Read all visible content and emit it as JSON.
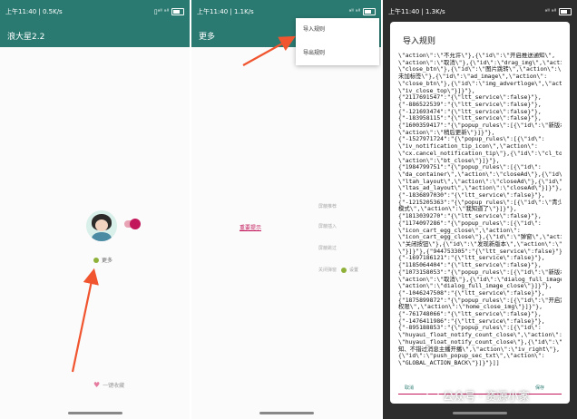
{
  "screen1": {
    "status_time": "上午11:40 | 0.5K/s",
    "status_right": "▯ᵃˡˡ ᵃˡˡ",
    "title": "浪大星2.2",
    "more_label": "更多",
    "favorite_label": "一键收藏"
  },
  "screen2": {
    "status_time": "上午11:40 | 1.1K/s",
    "status_right": "ᵃˡˡ ᵃˡˡ",
    "title": "更多",
    "menu": [
      {
        "label": "导入规则"
      },
      {
        "label": "导出规则"
      }
    ],
    "grey_labels": [
      "屏蔽推荐",
      "屏蔽插入",
      "屏蔽跳过",
      "关闭弹窗",
      "无障碍"
    ],
    "link_label": "重要提示",
    "settings_label": "设置"
  },
  "screen3": {
    "status_time": "上午11:40 | 1.3K/s",
    "dialog_title": "导入规则",
    "rules_text": "\\\"action\\\":\\\"不允许\\\"},{\\\"id\\\":\\\"开启推送通知\\\",\n\\\"action\\\":\\\"取消\\\"},{\\\"id\\\":\\\"drag_img\\\",\\\"action\\\":\n\\\"close_btn\\\"},{\\\"id\\\":\\\"图片跳转\\\",\\\"action\\\":\\\"此图片\n未加标签\\\"},{\\\"id\\\":\\\"ad_image\\\",\\\"action\\\":\n\\\"close_btn\\\"},{\\\"id\\\":\\\"img_advertloge\\\",\\\"action\\\":\n\\\"iv_close_top\\\"}]}\"},\n{\"2117691547\":\"{\\\"ltt_service\\\":false}\"},\n{\"-886522539\":\"{\\\"ltt_service\\\":false}\"},\n{\"-121693474\":\"{\\\"ltt_service\\\":false}\"},\n{\"-183958115\":\"{\\\"ltt_service\\\":false}\"},\n{\"1600359417\":\"{\\\"popup_rules\\\":[{\\\"id\\\":\\\"新版本\\\",\n\\\"action\\\":\\\"稍后更新\\\"}]}\"},\n{\"-1527971724\":\"{\\\"popup_rules\\\":[{\\\"id\\\":\n\\\"iv_notification_tip_icon\\\",\\\"action\\\":\n\\\"cx.cancel_notification_tip\\\"},{\\\"id\\\":\\\"cl_top\\\",\n\\\"action\\\":\\\"bt_close\\\"}]}\"},\n{\"1984799751\":\"{\\\"popup_rules\\\":[{\\\"id\\\":\n\\\"da_container\\\",\\\"action\\\":\\\"closeAd\\\"},{\\\"id\\\":\n\\\"ltah_layout\\\",\\\"action\\\":\\\"closeAd\\\"},{\\\"id\\\":\n\\\"ltas_ad_layout\\\",\\\"action\\\":\\\"closeAd\\\"}]}\"},\n{\"-1836897030\":\"{\\\"ltt_service\\\":false}\"},\n{\"-1215205363\":\"{\\\"popup_rules\\\":[{\\\"id\\\":\\\"青少年\n模式\\\",\\\"action\\\":\\\"我知道了\\\"}]}\"},\n{\"1813039270\":\"{\\\"ltt_service\\\":false}\"},\n{\"1174097286\":\"{\\\"popup_rules\\\":[{\\\"id\\\":\n\\\"icon_cart_egg_close\\\",\\\"action\\\":\n\\\"icon_cart_egg_close\\\"},{\\\"id\\\":\\\"弹窗\\\",\\\"action\\\":\n\\\"关闭按钮\\\"},{\\\"id\\\":\\\"发现新版本\\\",\\\"action\\\":\\\"取消\n\\\"}]}\"},{\"944753305\":\"{\\\"ltt_service\\\":false}\"},\n{\"-1697186121\":\"{\\\"ltt_service\\\":false}\"},\n{\"1185064404\":\"{\\\"ltt_service\\\":false}\"},\n{\"1073158053\":\"{\\\"popup_rules\\\":[{\\\"id\\\":\\\"新版本\\\",\n\\\"action\\\":\\\"取消\\\"},{\\\"id\\\":\\\"dialog_full_image\\\",\n\\\"action\\\":\\\"dialog_full_image_close\\\"}]}\"},\n{\"-1046247508\":\"{\\\"ltt_service\\\":false}\"},\n{\"1875899872\":\"{\\\"popup_rules\\\":[{\\\"id\\\":\\\"开启定位\n权限\\\",\\\"action\\\":\\\"home_close_img\\\"}]}\"},\n{\"-761748066\":\"{\\\"ltt_service\\\":false}\"},\n{\"-1476411986\":\"{\\\"ltt_service\\\":false}\"},\n{\"-895188853\":\"{\\\"popup_rules\\\":[{\\\"id\\\":\n\\\"huyaui_float_notify_count_close\\\",\\\"action\\\":\n\\\"huyaui_float_notify_count_close\\\"},{\\\"id\\\":\\\"开启通\n知、不错过消息主播开播\\\",\\\"action\\\":\\\"iv_right\\\"},\n{\\\"id\\\":\\\"push_popup_sec_txt\\\",\\\"action\\\":\n\\\"GLOBAL_ACTION_BACK\\\"}]}\"}]]",
    "cancel_label": "取消",
    "save_label": "保存"
  },
  "watermark": "公众号 · 资源小家",
  "colors": {
    "appbar": "#2a7a71",
    "accent": "#c2185b",
    "arrow": "#f0552f",
    "dark_bg": "#2d2d2d"
  }
}
